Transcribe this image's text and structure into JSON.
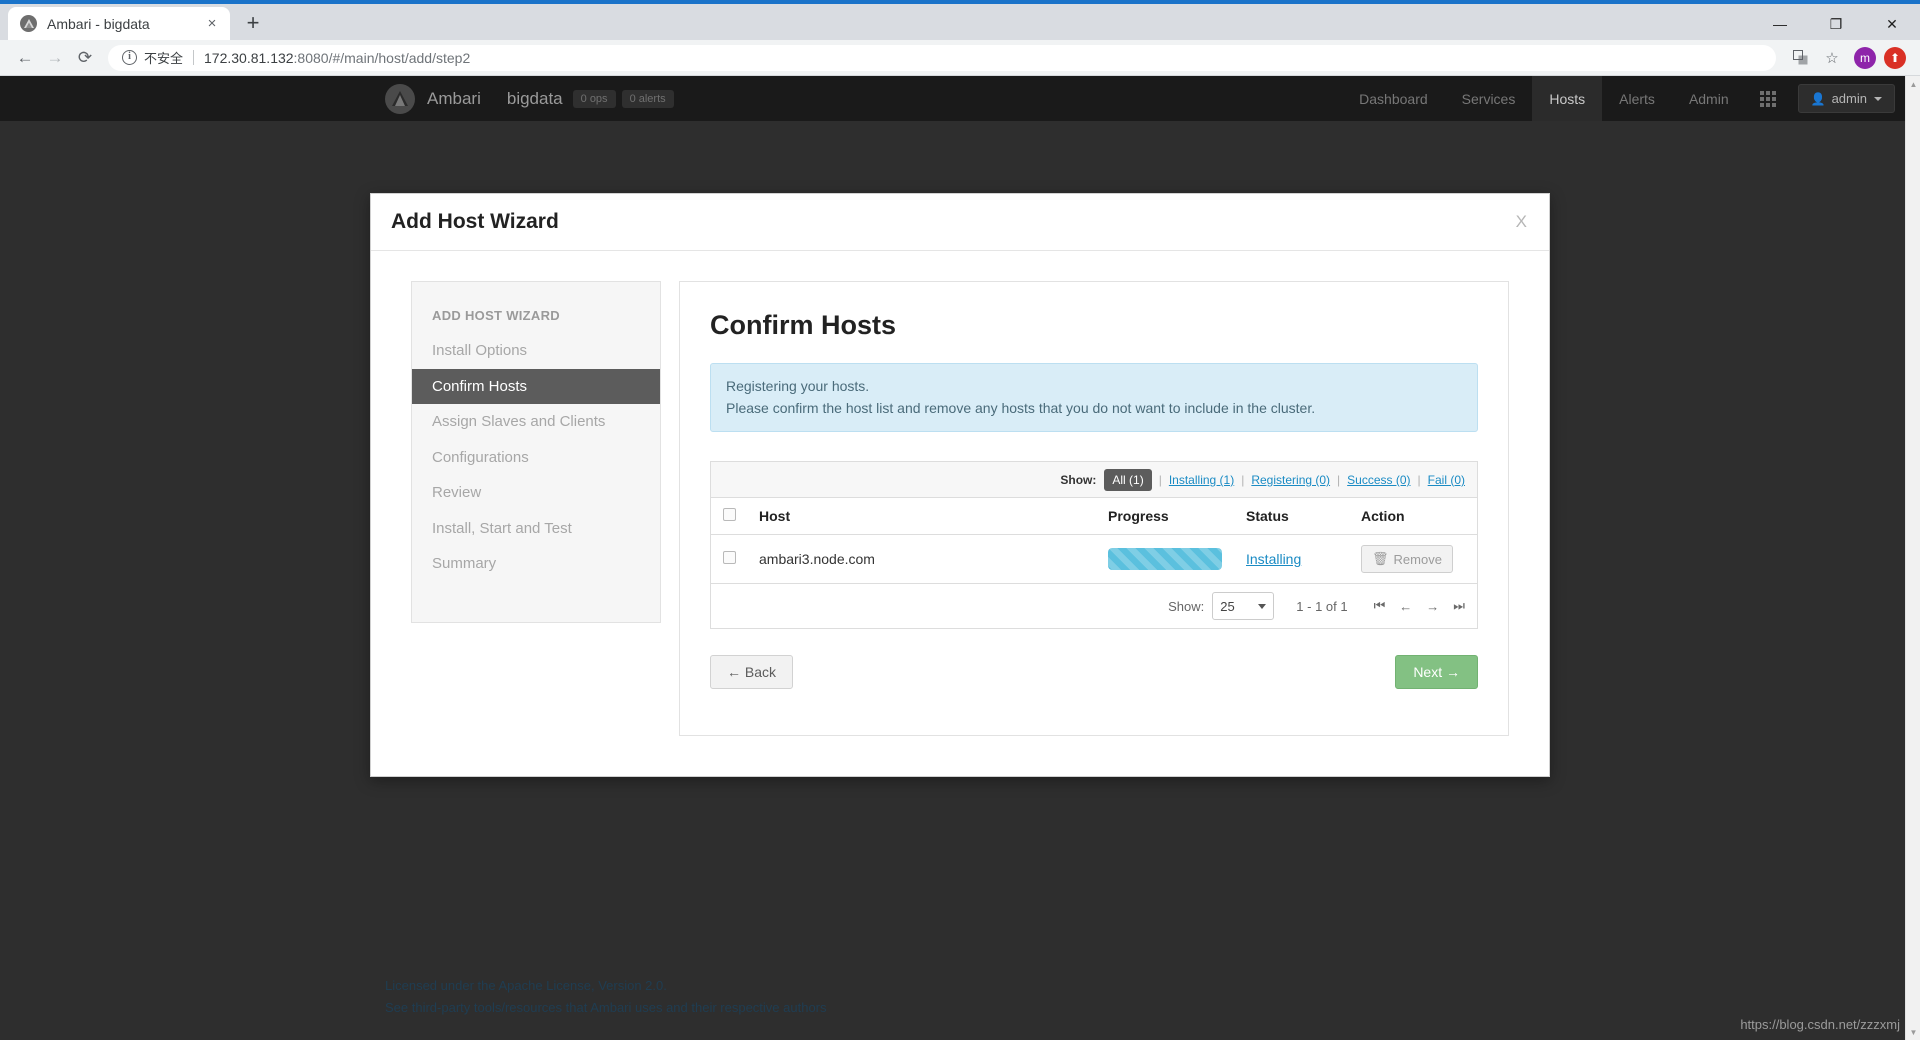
{
  "browser": {
    "tab": {
      "title": "Ambari - bigdata",
      "favicon": "ambari-favicon",
      "close": "×"
    },
    "new_tab": "+",
    "window_controls": {
      "minimize": "—",
      "maximize": "❐",
      "close": "✕"
    },
    "nav": {
      "back": "←",
      "forward": "→",
      "reload": "⟳"
    },
    "omnibox": {
      "info_icon": "i",
      "security_label": "不安全",
      "url_host": "172.30.81.132",
      "url_rest": ":8080/#/main/host/add/step2"
    },
    "toolbar_icons": {
      "translate": "translate-icon",
      "bookmark": "☆"
    },
    "profile_initial": "m",
    "update_glyph": "⬆"
  },
  "ambari_nav": {
    "logo": "ambari-logo",
    "brand": "Ambari",
    "cluster": "bigdata",
    "badges": [
      "0 ops",
      "0 alerts"
    ],
    "items": [
      {
        "label": "Dashboard",
        "active": false
      },
      {
        "label": "Services",
        "active": false
      },
      {
        "label": "Hosts",
        "active": true
      },
      {
        "label": "Alerts",
        "active": false
      },
      {
        "label": "Admin",
        "active": false
      }
    ],
    "grid_icon": "apps-grid-icon",
    "user": {
      "label": "admin",
      "icon": "user-icon"
    }
  },
  "modal": {
    "title": "Add Host Wizard",
    "close_label": "X"
  },
  "wizard": {
    "heading": "ADD HOST WIZARD",
    "steps": [
      {
        "label": "Install Options",
        "active": false
      },
      {
        "label": "Confirm Hosts",
        "active": true
      },
      {
        "label": "Assign Slaves and Clients",
        "active": false
      },
      {
        "label": "Configurations",
        "active": false
      },
      {
        "label": "Review",
        "active": false
      },
      {
        "label": "Install, Start and Test",
        "active": false
      },
      {
        "label": "Summary",
        "active": false
      }
    ]
  },
  "content": {
    "title": "Confirm Hosts",
    "alert_line1": "Registering your hosts.",
    "alert_line2": "Please confirm the host list and remove any hosts that you do not want to include in the cluster."
  },
  "filter": {
    "label": "Show:",
    "active": "All (1)",
    "separator": "|",
    "links": [
      "Installing (1)",
      "Registering (0)",
      "Success (0)",
      "Fail (0)"
    ]
  },
  "table": {
    "columns": [
      "Host",
      "Progress",
      "Status",
      "Action"
    ],
    "rows": [
      {
        "host": "ambari3.node.com",
        "progress_percent": 100,
        "status": "Installing",
        "action_label": "Remove",
        "action_icon": "trash-icon",
        "selected": false
      }
    ]
  },
  "pager": {
    "label": "Show:",
    "page_size": "25",
    "range": "1 - 1 of 1",
    "first": "⏮",
    "prev": "←",
    "next": "→",
    "last": "⏭"
  },
  "buttons": {
    "back": "← Back",
    "next": "Next →"
  },
  "footer": {
    "line1": "Licensed under the Apache License, Version 2.0.",
    "line2": "See third-party tools/resources that Ambari uses and their respective authors"
  },
  "watermark": "https://blog.csdn.net/zzzxmj",
  "colors": {
    "accent_link": "#1a8bc4",
    "progress": "#5bc0de",
    "next_button": "#83c183",
    "active_step": "#5c5c5c",
    "alert_bg": "#d9edf7"
  }
}
